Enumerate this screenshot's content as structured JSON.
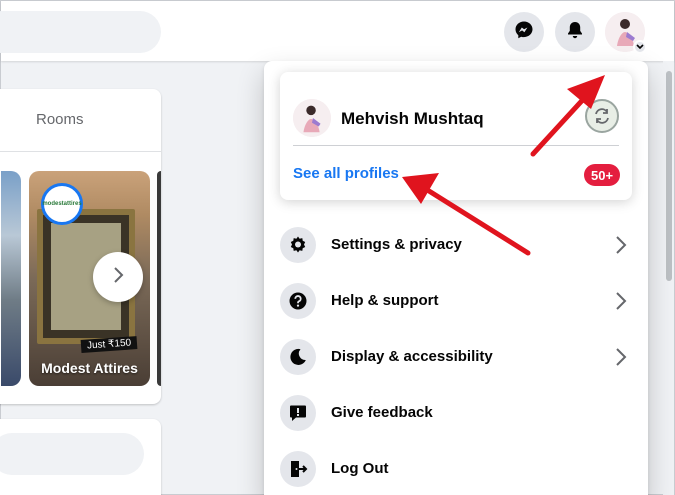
{
  "feed": {
    "rooms_label": "Rooms",
    "story": {
      "title": "Modest Attires",
      "logo_text": "modestattires",
      "price_tag": "Just ₹150"
    }
  },
  "account_menu": {
    "profile": {
      "name": "Mehvish Mushtaq",
      "see_all_label": "See all profiles",
      "badge": "50+"
    },
    "items": [
      {
        "label": "Settings & privacy",
        "icon": "gear-icon",
        "has_chevron": true
      },
      {
        "label": "Help & support",
        "icon": "question-icon",
        "has_chevron": true
      },
      {
        "label": "Display & accessibility",
        "icon": "moon-icon",
        "has_chevron": true
      },
      {
        "label": "Give feedback",
        "icon": "feedback-icon",
        "has_chevron": false
      },
      {
        "label": "Log Out",
        "icon": "logout-icon",
        "has_chevron": false
      }
    ]
  },
  "colors": {
    "link_blue": "#1877f2",
    "badge_red": "#e41e3f",
    "annotation_red": "#e0141e",
    "icon_bg": "#e4e6eb"
  }
}
